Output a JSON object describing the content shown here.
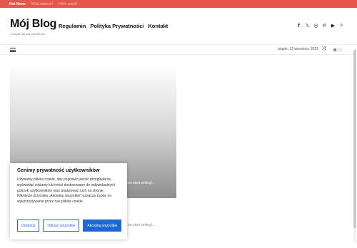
{
  "topbar": {
    "hot_label": "Hot News",
    "items": [
      "Witaj świecie!",
      "Hello world!"
    ]
  },
  "header": {
    "logo": "Mój Blog",
    "tagline": "Kolejna witryna WordPress",
    "menu": [
      "Regulamin",
      "Polityka Prywatności",
      "Kontakt"
    ],
    "social_icons": [
      "facebook-icon",
      "x-icon",
      "instagram-icon",
      "pinterest-icon",
      "youtube-icon",
      "search-icon"
    ]
  },
  "subbar": {
    "date": "piątek, 12 września, 2025"
  },
  "posts": {
    "excerpt_1": "...en start writing!...",
    "excerpt_2": "...en start writing!...",
    "read_more": "Read More"
  },
  "cookie": {
    "title": "Cenimy prywatność użytkowników",
    "body": "Używamy plików cookie, aby poprawić jakość przeglądania, wyświetlać reklamy lub treści dostosowane do indywidualnych potrzeb użytkowników oraz analizować ruch na stronie. Kliknięcie przycisku „Akceptuj wszystkie” oznacza zgodę na wykorzystywanie przez nas plików cookie.",
    "customize": "Dostosuj",
    "reject": "Odrzuć wszystkie",
    "accept": "Akceptuj wszystkie"
  }
}
